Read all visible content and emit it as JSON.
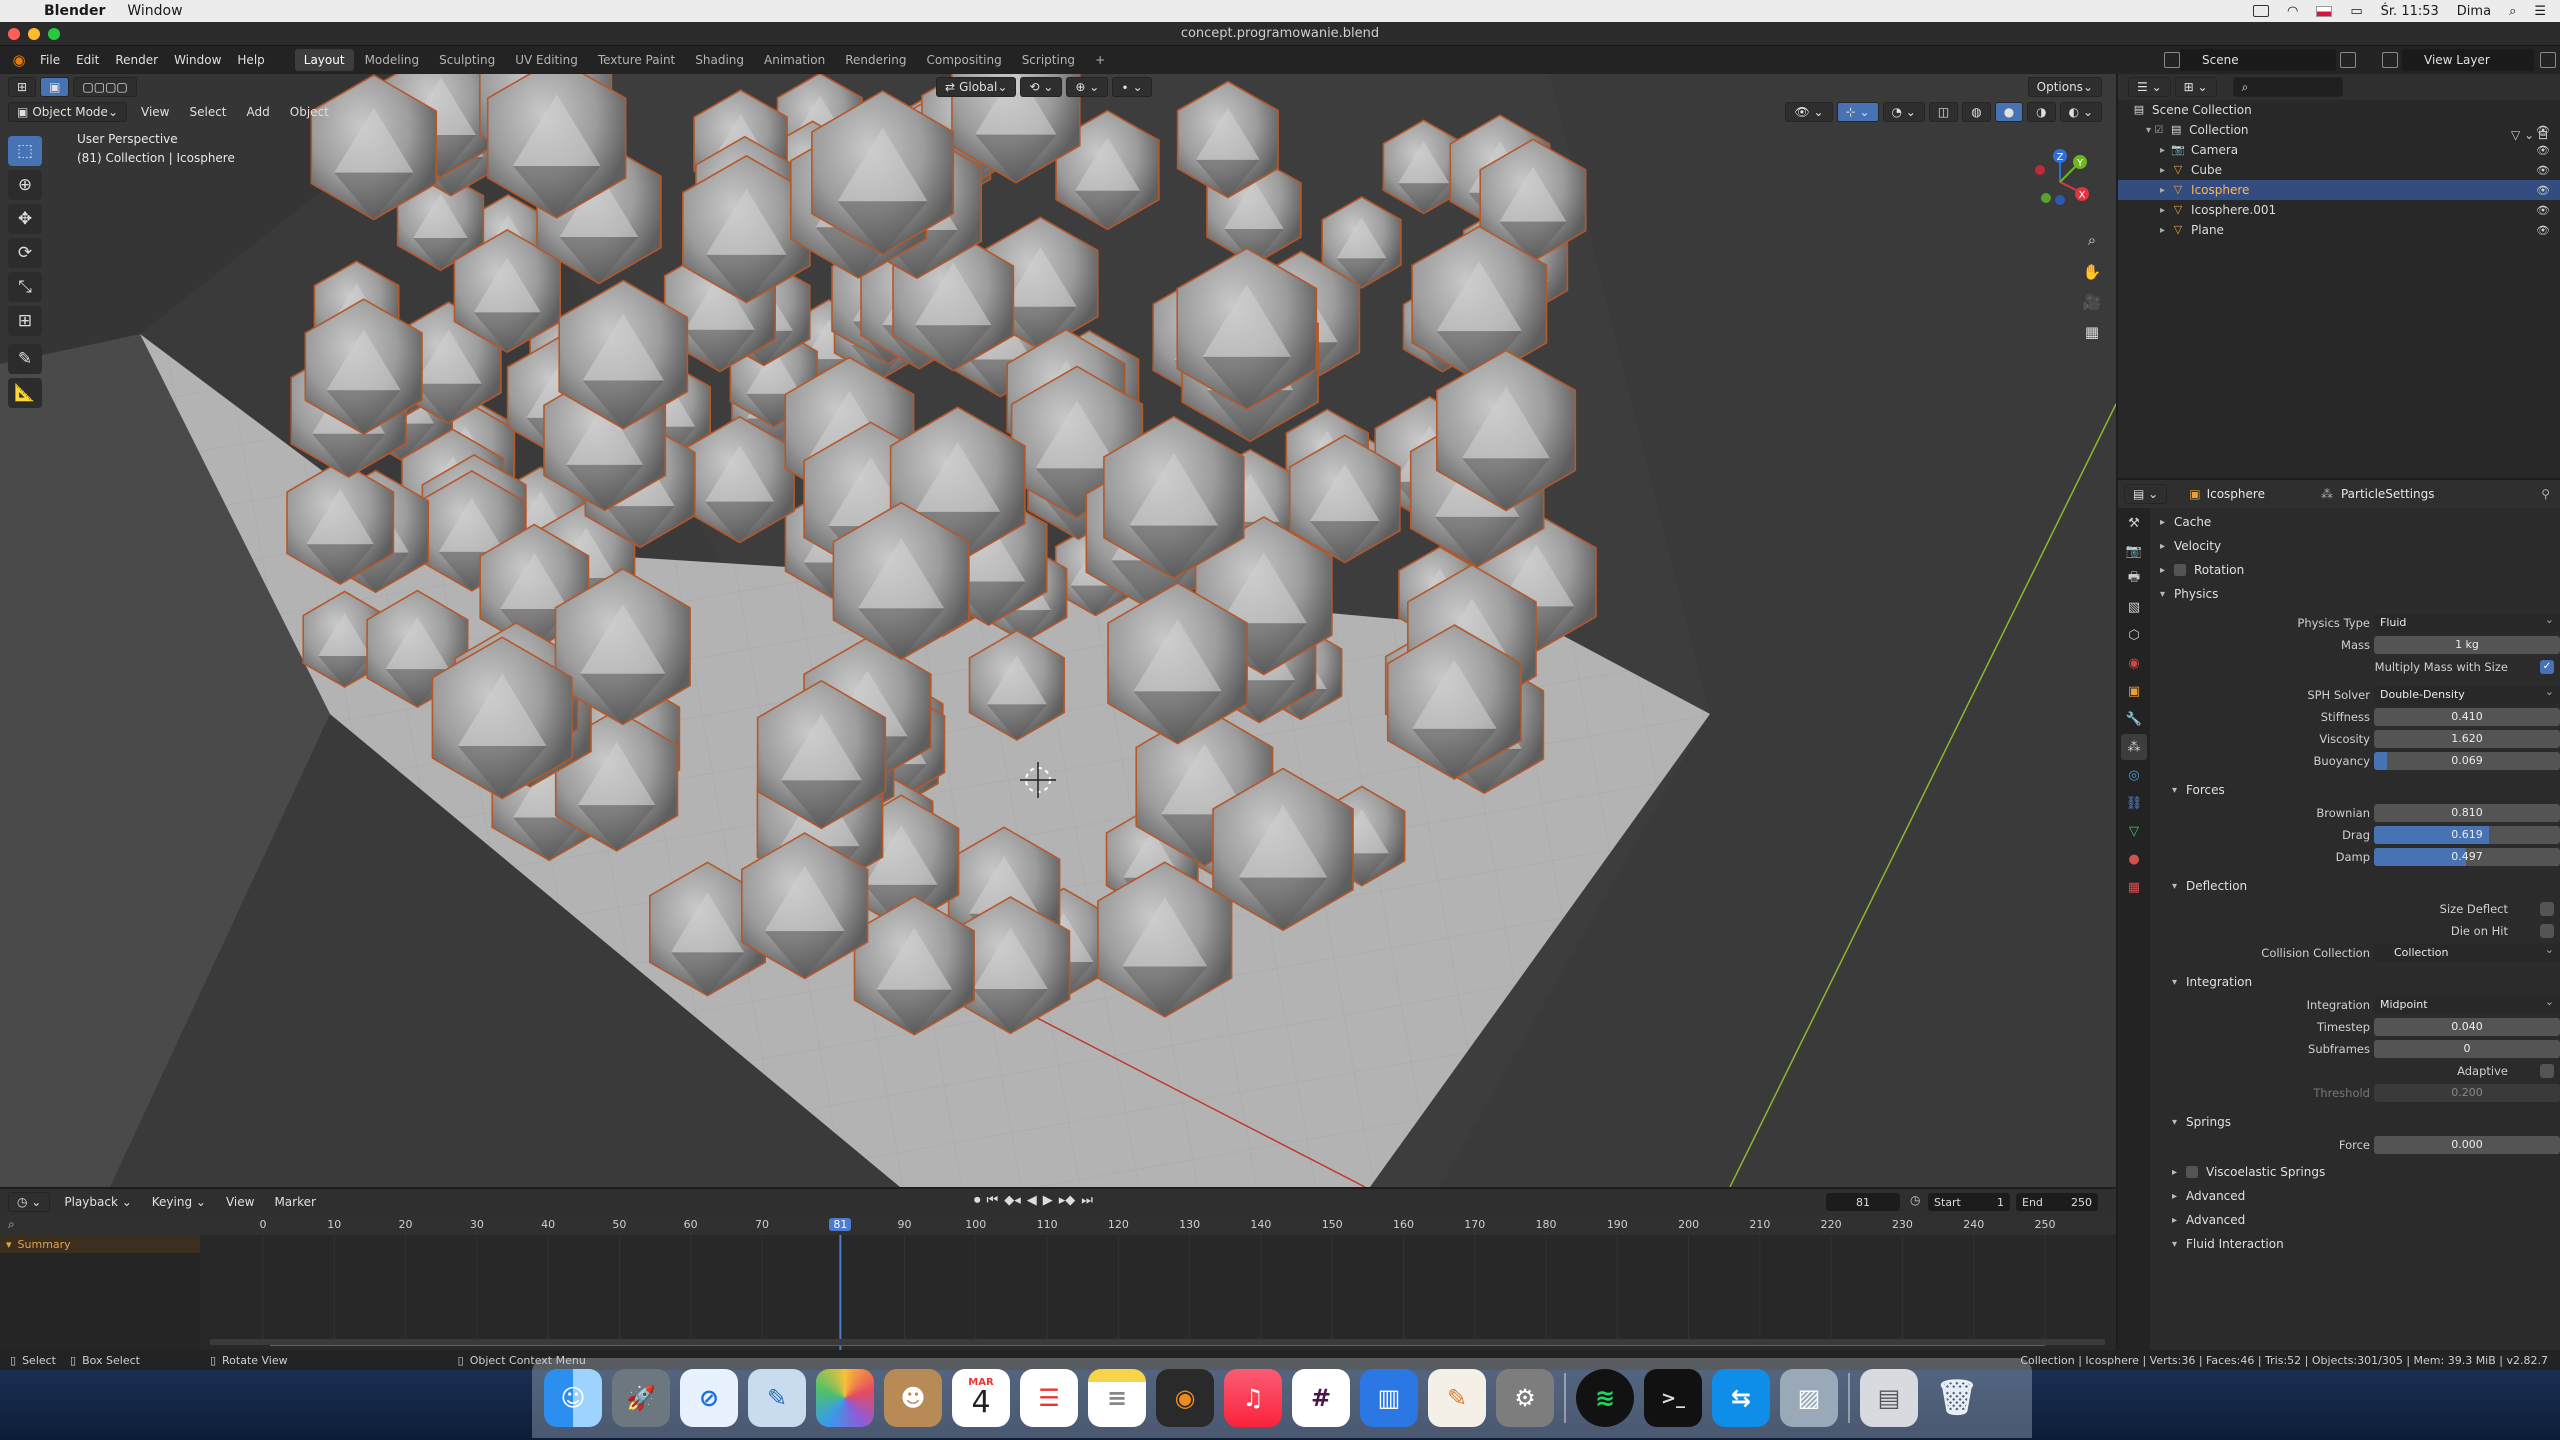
{
  "mac_menubar": {
    "app": "Blender",
    "menu": "Window",
    "clock": "Śr. 11:53",
    "user": "Dima"
  },
  "window": {
    "title": "concept.programowanie.blend"
  },
  "topbar": {
    "menus": [
      "File",
      "Edit",
      "Render",
      "Window",
      "Help"
    ],
    "workspaces": [
      "Layout",
      "Modeling",
      "Sculpting",
      "UV Editing",
      "Texture Paint",
      "Shading",
      "Animation",
      "Rendering",
      "Compositing",
      "Scripting",
      "+"
    ],
    "active_workspace": "Layout",
    "scene": "Scene",
    "view_layer": "View Layer"
  },
  "viewport": {
    "mode": "Object Mode",
    "menus": [
      "View",
      "Select",
      "Add",
      "Object"
    ],
    "orientation": "Global",
    "options": "Options",
    "perspective": "User Perspective",
    "collection_info": "(81) Collection | Icosphere",
    "gizmo": {
      "x": "X",
      "y": "Y",
      "z": "Z"
    }
  },
  "outliner": {
    "root": "Scene Collection",
    "items": [
      {
        "name": "Collection",
        "icon": "collection-icon",
        "depth": 1
      },
      {
        "name": "Camera",
        "icon": "camera-icon",
        "depth": 2
      },
      {
        "name": "Cube",
        "icon": "mesh-icon",
        "depth": 2
      },
      {
        "name": "Icosphere",
        "icon": "mesh-icon",
        "depth": 2,
        "selected": true
      },
      {
        "name": "Icosphere.001",
        "icon": "mesh-icon",
        "depth": 2
      },
      {
        "name": "Plane",
        "icon": "mesh-icon",
        "depth": 2
      }
    ]
  },
  "properties": {
    "object": "Icosphere",
    "settings": "ParticleSettings",
    "cache": "Cache",
    "velocity": "Velocity",
    "rotation": "Rotation",
    "physics": "Physics",
    "physics_type_label": "Physics Type",
    "physics_type": "Fluid",
    "mass_label": "Mass",
    "mass": "1 kg",
    "multiply_mass": "Multiply Mass with Size",
    "sph_solver_label": "SPH Solver",
    "sph_solver": "Double-Density",
    "stiffness_label": "Stiffness",
    "stiffness": "0.410",
    "viscosity_label": "Viscosity",
    "viscosity": "1.620",
    "buoyancy_label": "Buoyancy",
    "buoyancy": "0.069",
    "buoyancy_fill": 0.069,
    "forces": "Forces",
    "brownian_label": "Brownian",
    "brownian": "0.810",
    "drag_label": "Drag",
    "drag": "0.619",
    "drag_fill": 0.619,
    "damp_label": "Damp",
    "damp": "0.497",
    "damp_fill": 0.497,
    "deflection": "Deflection",
    "size_deflect": "Size Deflect",
    "die_on_hit": "Die on Hit",
    "collision_label": "Collision Collection",
    "collision": "Collection",
    "integration_section": "Integration",
    "integration_label": "Integration",
    "integration": "Midpoint",
    "timestep_label": "Timestep",
    "timestep": "0.040",
    "subframes_label": "Subframes",
    "subframes": "0",
    "adaptive": "Adaptive",
    "threshold_label": "Threshold",
    "threshold": "0.200",
    "springs": "Springs",
    "force_label": "Force",
    "force": "0.000",
    "viscoelastic": "Viscoelastic Springs",
    "advanced1": "Advanced",
    "advanced2": "Advanced",
    "fluid_interaction": "Fluid Interaction"
  },
  "timeline": {
    "menus": [
      "Playback",
      "Keying",
      "View",
      "Marker"
    ],
    "current_frame": "81",
    "start_label": "Start",
    "start": "1",
    "end_label": "End",
    "end": "250",
    "ticks": [
      "0",
      "10",
      "20",
      "30",
      "40",
      "50",
      "60",
      "70",
      "81",
      "90",
      "100",
      "110",
      "120",
      "130",
      "140",
      "150",
      "160",
      "170",
      "180",
      "190",
      "200",
      "210",
      "220",
      "230",
      "240",
      "250"
    ],
    "summary": "Summary"
  },
  "statusbar": {
    "select": "Select",
    "box_select": "Box Select",
    "rotate": "Rotate View",
    "context": "Object Context Menu",
    "stats": "Collection | Icosphere | Verts:36 | Faces:46 | Tris:52 | Objects:301/305 | Mem: 39.3 MiB | v2.82.7"
  },
  "dock": {
    "calendar_month": "MAR",
    "calendar_day": "4"
  }
}
